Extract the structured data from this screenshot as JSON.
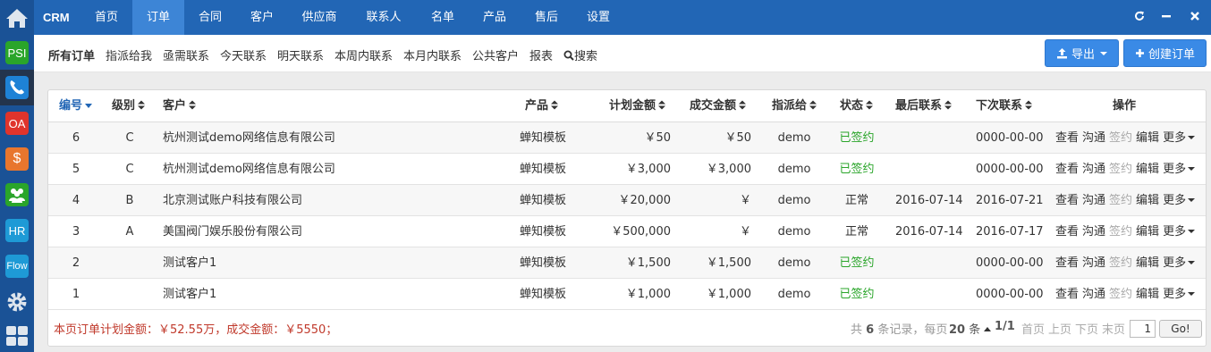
{
  "sidebar": {
    "items": [
      {
        "icon": "home-icon"
      },
      {
        "label": "PSI",
        "color": "#2aa52a"
      },
      {
        "icon": "phone-icon"
      },
      {
        "label": "OA",
        "color": "#e0342c"
      },
      {
        "label": "$",
        "color": "#e8762d"
      },
      {
        "icon": "users-icon",
        "color": "#2aa52a"
      },
      {
        "label": "HR",
        "color": "#1e9ad6"
      },
      {
        "label": "Flow",
        "color": "#1e9ad6"
      },
      {
        "icon": "gear-icon"
      },
      {
        "icon": "grid-icon"
      }
    ]
  },
  "topnav": {
    "brand": "CRM",
    "items": [
      "首页",
      "订单",
      "合同",
      "客户",
      "供应商",
      "联系人",
      "名单",
      "产品",
      "售后",
      "设置"
    ],
    "active_index": 1
  },
  "subnav": {
    "items": [
      "所有订单",
      "指派给我",
      "亟需联系",
      "今天联系",
      "明天联系",
      "本周内联系",
      "本月内联系",
      "公共客户",
      "报表",
      "搜索"
    ],
    "export_label": "导出",
    "create_label": "创建订单"
  },
  "table": {
    "columns": [
      "编号",
      "级别",
      "客户",
      "产品",
      "计划金额",
      "成交金额",
      "指派给",
      "状态",
      "最后联系",
      "下次联系",
      "操作"
    ],
    "rows": [
      {
        "id": "6",
        "level": "C",
        "customer": "杭州测试demo网络信息有限公司",
        "product": "蝉知模板",
        "plan": "￥50",
        "deal": "￥50",
        "assign": "demo",
        "status": "已签约",
        "status_signed": true,
        "last": "",
        "next": "0000-00-00"
      },
      {
        "id": "5",
        "level": "C",
        "customer": "杭州测试demo网络信息有限公司",
        "product": "蝉知模板",
        "plan": "￥3,000",
        "deal": "￥3,000",
        "assign": "demo",
        "status": "已签约",
        "status_signed": true,
        "last": "",
        "next": "0000-00-00"
      },
      {
        "id": "4",
        "level": "B",
        "customer": "北京测试账户科技有限公司",
        "product": "蝉知模板",
        "plan": "￥20,000",
        "deal": "￥",
        "assign": "demo",
        "status": "正常",
        "status_signed": false,
        "last": "2016-07-14",
        "next": "2016-07-21"
      },
      {
        "id": "3",
        "level": "A",
        "customer": "美国阀门娱乐股份有限公司",
        "product": "蝉知模板",
        "plan": "￥500,000",
        "deal": "￥",
        "assign": "demo",
        "status": "正常",
        "status_signed": false,
        "last": "2016-07-14",
        "next": "2016-07-17"
      },
      {
        "id": "2",
        "level": "",
        "customer": "测试客户1",
        "product": "蝉知模板",
        "plan": "￥1,500",
        "deal": "￥1,500",
        "assign": "demo",
        "status": "已签约",
        "status_signed": true,
        "last": "",
        "next": "0000-00-00"
      },
      {
        "id": "1",
        "level": "",
        "customer": "测试客户1",
        "product": "蝉知模板",
        "plan": "￥1,000",
        "deal": "￥1,000",
        "assign": "demo",
        "status": "已签约",
        "status_signed": true,
        "last": "",
        "next": "0000-00-00"
      }
    ],
    "actions": [
      "查看",
      "沟通",
      "签约",
      "编辑",
      "更多"
    ]
  },
  "footer": {
    "summary": "本页订单计划金额：￥52.55万，成交金额：￥5550；",
    "total_prefix": "共",
    "total_count": "6",
    "total_suffix": "条记录，每页",
    "per_page": "20",
    "per_page_suffix": "条",
    "page_info": "1/1",
    "first": "首页",
    "prev": "上页",
    "next": "下页",
    "last": "末页",
    "page_input": "1",
    "go": "Go!"
  },
  "colors": {
    "nav_bg": "#2266b5",
    "nav_active": "#3d85d6",
    "sidebar_bg": "#1a5296",
    "button_primary": "#3a8ae6",
    "signed_green": "#2aa52a",
    "summary_red": "#c0392b"
  }
}
